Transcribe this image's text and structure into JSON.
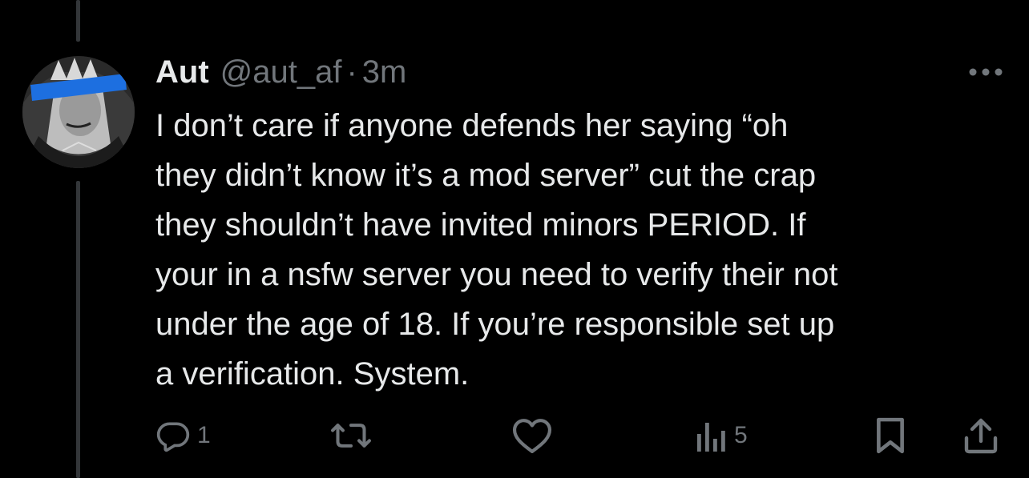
{
  "tweet": {
    "display_name": "Aut",
    "handle": "@aut_af",
    "separator": "·",
    "time": "3m",
    "text_lines": [
      "I don’t care if anyone defends her saying “oh",
      "they didn’t know it’s a mod server” cut the crap",
      "they shouldn’t have invited minors PERIOD. If",
      "your in a nsfw server you need to verify their not",
      "under the age of 18. If you’re responsible set up",
      "a verification. System."
    ]
  },
  "actions": {
    "reply_count": "1",
    "repost_count": "",
    "like_count": "",
    "views_count": "5"
  },
  "icons": {
    "avatar": "avatar-image",
    "more": "more-horizontal-icon",
    "reply": "reply-icon",
    "repost": "repost-icon",
    "like": "heart-icon",
    "views": "views-icon",
    "bookmark": "bookmark-icon",
    "share": "share-icon"
  },
  "colors": {
    "background": "#000000",
    "text": "#e7e9ea",
    "secondary": "#71767b",
    "thread_line": "#333639",
    "avatar_bar": "#1d6fe0"
  }
}
